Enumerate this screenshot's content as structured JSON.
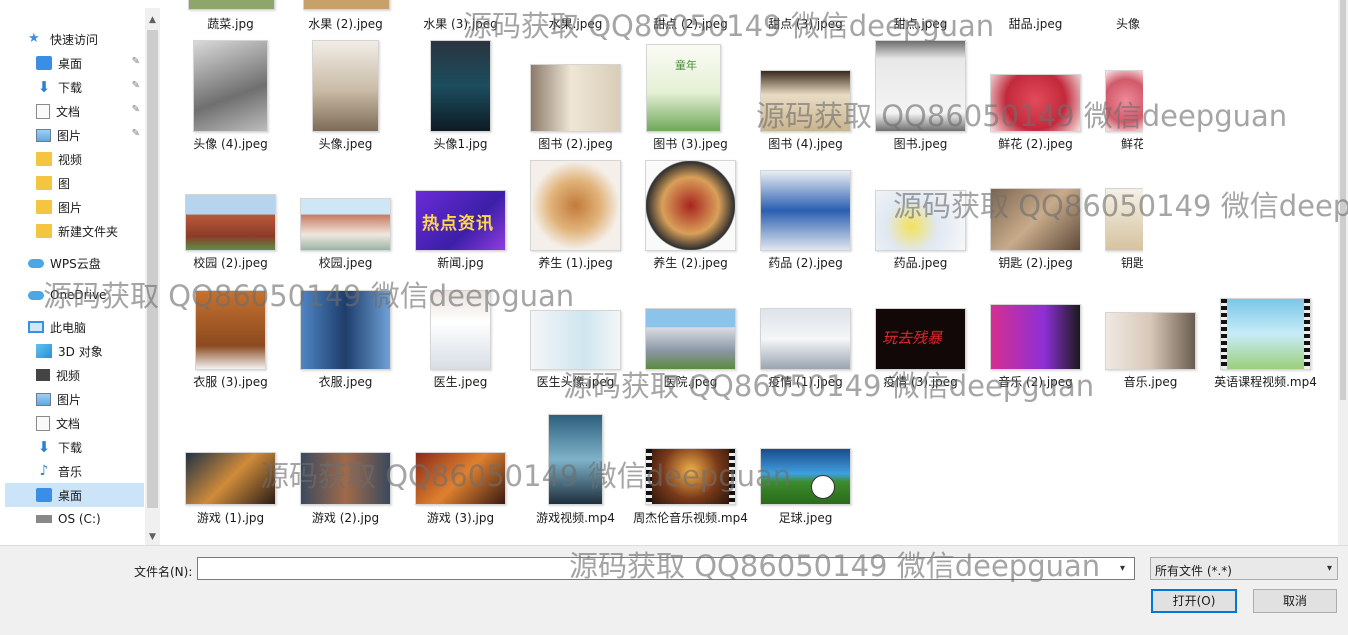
{
  "nav": {
    "items": [
      {
        "label": "快速访问",
        "icon": "star-icon",
        "pinned": false
      },
      {
        "label": "桌面",
        "icon": "desktop-icon",
        "pinned": true
      },
      {
        "label": "下载",
        "icon": "download-icon",
        "pinned": true
      },
      {
        "label": "文档",
        "icon": "document-icon",
        "pinned": true
      },
      {
        "label": "图片",
        "icon": "picture-icon",
        "pinned": true
      },
      {
        "label": "视频",
        "icon": "folder-icon",
        "pinned": false
      },
      {
        "label": "图",
        "icon": "folder-icon",
        "pinned": false
      },
      {
        "label": "图片",
        "icon": "folder-icon",
        "pinned": false
      },
      {
        "label": "新建文件夹",
        "icon": "folder-icon",
        "pinned": false
      },
      {
        "label": "WPS云盘",
        "icon": "cloud-icon",
        "pinned": false
      },
      {
        "label": "OneDrive",
        "icon": "cloud-icon",
        "pinned": false
      },
      {
        "label": "此电脑",
        "icon": "computer-icon",
        "pinned": false
      },
      {
        "label": "3D 对象",
        "icon": "cube-icon",
        "pinned": false
      },
      {
        "label": "视频",
        "icon": "video-icon",
        "pinned": false
      },
      {
        "label": "图片",
        "icon": "picture-icon",
        "pinned": false
      },
      {
        "label": "文档",
        "icon": "document-icon",
        "pinned": false
      },
      {
        "label": "下载",
        "icon": "download-icon",
        "pinned": false
      },
      {
        "label": "音乐",
        "icon": "music-icon",
        "pinned": false
      },
      {
        "label": "桌面",
        "icon": "desktop-icon",
        "pinned": false,
        "selected": true
      },
      {
        "label": "OS (C:)",
        "icon": "drive-icon",
        "pinned": false
      }
    ],
    "pin_glyph": "📌"
  },
  "files": {
    "row0": [
      "蔬菜.jpg",
      "水果 (2).jpeg",
      "水果 (3).jpeg",
      "水果.jpeg",
      "甜点 (2).jpeg",
      "甜点 (3).jpeg",
      "甜点.jpeg",
      "甜品.jpeg",
      "头像"
    ],
    "row1": [
      "头像 (4).jpeg",
      "头像.jpeg",
      "头像1.jpg",
      "图书 (2).jpeg",
      "图书 (3).jpeg",
      "图书 (4).jpeg",
      "图书.jpeg",
      "鲜花 (2).jpeg",
      "鲜花"
    ],
    "row2": [
      "校园 (2).jpeg",
      "校园.jpeg",
      "新闻.jpg",
      "养生 (1).jpeg",
      "养生 (2).jpeg",
      "药品 (2).jpeg",
      "药品.jpeg",
      "钥匙 (2).jpeg",
      "钥匙"
    ],
    "row3": [
      "衣服 (3).jpeg",
      "衣服.jpeg",
      "医生.jpeg",
      "医生头像.jpeg",
      "医院.jpeg",
      "疫情 (1).jpeg",
      "疫情 (3).jpeg",
      "音乐 (2).jpeg",
      "音乐.jpeg",
      "英语课程视频.mp4"
    ],
    "row4": [
      "游戏 (1).jpg",
      "游戏 (2).jpg",
      "游戏 (3).jpg",
      "游戏视频.mp4",
      "周杰伦音乐视频.mp4",
      "足球.jpeg"
    ],
    "news_thumb_text": "热点资讯",
    "book_thumb_text": "童年",
    "game_thumb_text": "玩去残暴"
  },
  "bottom": {
    "filename_label": "文件名(N):",
    "filename_value": "",
    "filter_value": "所有文件 (*.*)",
    "open_label": "打开(O)",
    "cancel_label": "取消"
  },
  "watermark": "源码获取 QQ86050149 微信deepguan",
  "colors": {
    "selected": "#cce4f7",
    "accent": "#0078d7",
    "background": "#f0f0f0"
  }
}
